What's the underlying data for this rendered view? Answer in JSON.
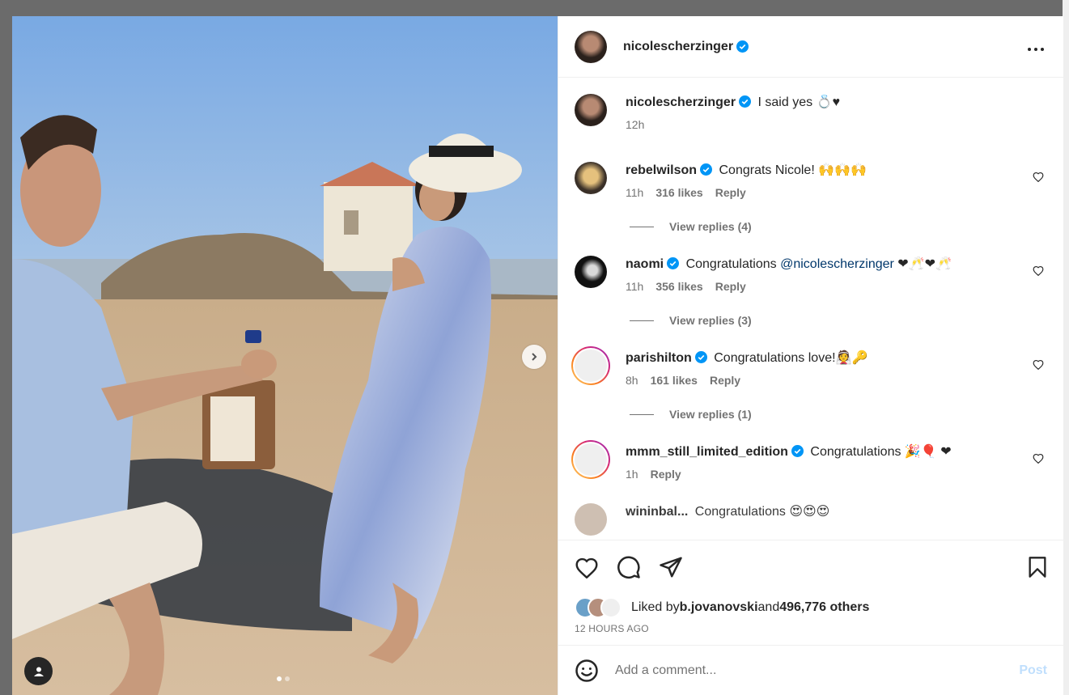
{
  "post": {
    "author": "nicolescherzinger",
    "caption": "I said yes 💍♥",
    "caption_time": "12h"
  },
  "comments": [
    {
      "user": "rebelwilson",
      "text": "Congrats Nicole! 🙌🙌🙌",
      "time": "11h",
      "likes": "316 likes",
      "reply": "Reply",
      "view_replies": "View replies (4)"
    },
    {
      "user": "naomi",
      "text_before": "Congratulations ",
      "mention": "@nicolescherzinger",
      "text_after": " ❤🥂❤🥂",
      "time": "11h",
      "likes": "356 likes",
      "reply": "Reply",
      "view_replies": "View replies (3)"
    },
    {
      "user": "parishilton",
      "text": "Congratulations love!👰🔑",
      "time": "8h",
      "likes": "161 likes",
      "reply": "Reply",
      "view_replies": "View replies (1)"
    },
    {
      "user": "mmm_still_limited_edition",
      "text": "Congratulations 🎉🎈 ❤",
      "time": "1h",
      "reply": "Reply"
    },
    {
      "user": "wininbal...",
      "text": "Congratulations 😍😍😍"
    }
  ],
  "likes": {
    "prefix": "Liked by ",
    "user": "b.jovanovski",
    "middle": " and ",
    "count": "496,776 others"
  },
  "post_time": "12 HOURS AGO",
  "composer": {
    "placeholder": "Add a comment...",
    "post_label": "Post"
  },
  "icons": [
    "more-icon",
    "heart-icon",
    "comment-icon",
    "share-icon",
    "bookmark-icon",
    "emoji-icon",
    "verified-icon",
    "chevron-right-icon",
    "user-tag-icon"
  ],
  "colors": {
    "verified": "#0095f6",
    "link": "#00376b",
    "post_disabled": "#c0dffd",
    "heart_red": "#ed4956"
  }
}
